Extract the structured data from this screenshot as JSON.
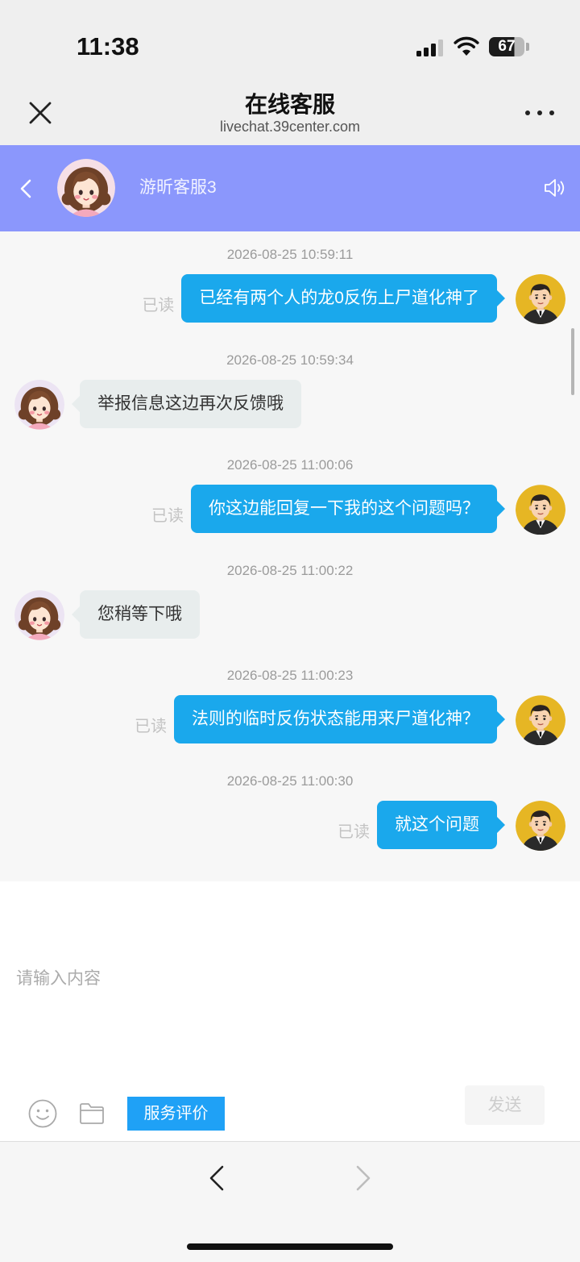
{
  "status_bar": {
    "time": "11:38",
    "battery_level": "67"
  },
  "browser": {
    "title": "在线客服",
    "url": "livechat.39center.com"
  },
  "chat_header": {
    "agent_name": "游昕客服3"
  },
  "messages": [
    {
      "time": "2026-08-25 10:59:11",
      "text": "已经有两个人的龙0反伤上尸道化神了",
      "status": "已读"
    },
    {
      "time": "2026-08-25 10:59:34",
      "text": "举报信息这边再次反馈哦"
    },
    {
      "time": "2026-08-25 11:00:06",
      "text": "你这边能回复一下我的这个问题吗？",
      "status": "已读"
    },
    {
      "time": "2026-08-25 11:00:22",
      "text": "您稍等下哦"
    },
    {
      "time": "2026-08-25 11:00:23",
      "text": "法则的临时反伤状态能用来尸道化神？",
      "status": "已读"
    },
    {
      "time": "2026-08-25 11:00:30",
      "text": "就这个问题",
      "status": "已读"
    }
  ],
  "composer": {
    "placeholder": "请输入内容",
    "rate_service_label": "服务评价",
    "send_label": "发送"
  },
  "colors": {
    "chat_header": "#8b97fc",
    "user_bubble": "#1aa8ec",
    "agent_bubble": "#e8eded",
    "rate_button": "#1fa1f6",
    "user_avatar_bg": "#e6b624"
  },
  "icons": {
    "signal": "signal-icon",
    "wifi": "wifi-icon",
    "battery": "battery-icon",
    "close": "close-icon",
    "more": "more-icon",
    "back": "chevron-left-icon",
    "sound": "speaker-icon",
    "emoji": "smile-icon",
    "file": "folder-icon",
    "nav_back": "chevron-left-icon",
    "nav_forward": "chevron-right-icon"
  }
}
